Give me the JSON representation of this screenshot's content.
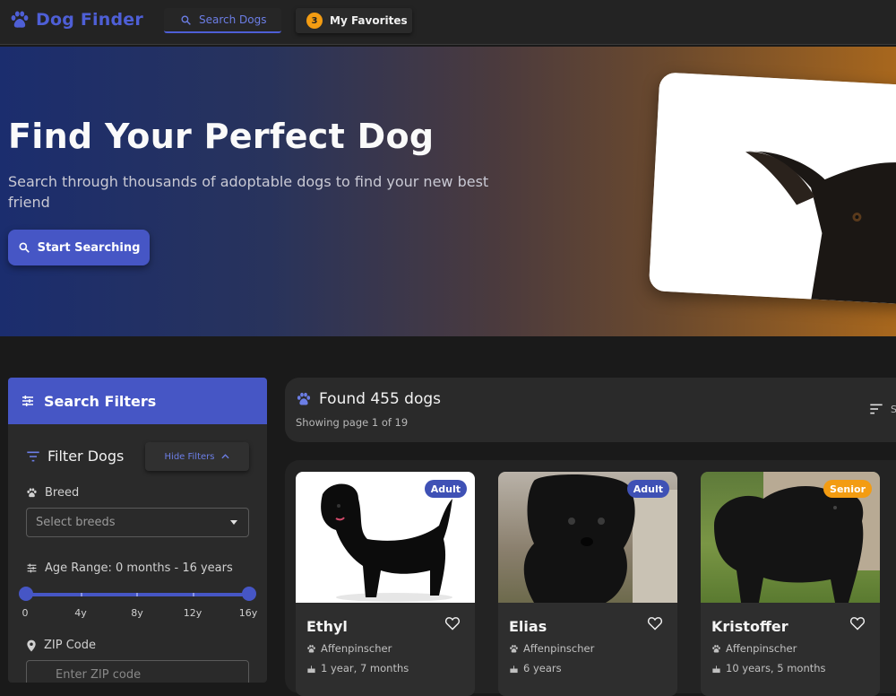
{
  "nav": {
    "brand": "Dog Finder",
    "tabs": [
      {
        "label": "Search Dogs",
        "icon": "search-icon"
      },
      {
        "label": "My Favorites",
        "badge": "3"
      }
    ]
  },
  "hero": {
    "title": "Find Your Perfect Dog",
    "subtitle": "Search through thousands of adoptable dogs to find your new best friend",
    "cta": "Start Searching"
  },
  "filters": {
    "header": "Search Filters",
    "section_title": "Filter Dogs",
    "hide_label": "Hide Filters",
    "breed_label": "Breed",
    "breed_placeholder": "Select breeds",
    "age_label": "Age Range: 0 months - 16 years",
    "age_range": [
      0,
      16
    ],
    "age_ticks": [
      "0",
      "4y",
      "8y",
      "12y",
      "16y"
    ],
    "zip_label": "ZIP Code",
    "zip_placeholder": "Enter ZIP code"
  },
  "results": {
    "found": "Found 455 dogs",
    "showing": "Showing page 1 of 19",
    "sort_label": "S"
  },
  "dogs": [
    {
      "name": "Ethyl",
      "breed": "Affenpinscher",
      "age": "1 year, 7 months",
      "badge": "Adult",
      "badge_color": "#3f51b5"
    },
    {
      "name": "Elias",
      "breed": "Affenpinscher",
      "age": "6 years",
      "badge": "Adult",
      "badge_color": "#3f51b5"
    },
    {
      "name": "Kristoffer",
      "breed": "Affenpinscher",
      "age": "10 years, 5 months",
      "badge": "Senior",
      "badge_color": "#f39c12"
    }
  ],
  "colors": {
    "accent": "#4656c5",
    "warning": "#f39c12"
  }
}
